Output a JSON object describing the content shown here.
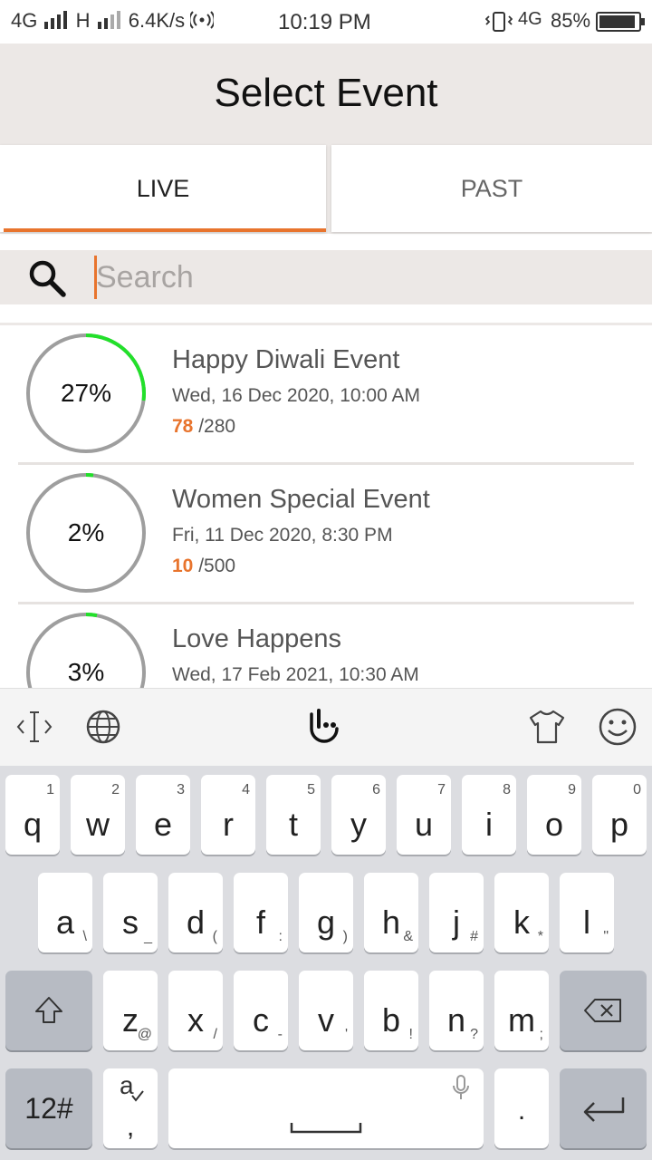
{
  "status_bar": {
    "network_left": "4G",
    "network_h": "H",
    "speed": "6.4K/s",
    "time": "10:19 PM",
    "network_right": "4G",
    "battery": "85%"
  },
  "header": {
    "title": "Select Event"
  },
  "tabs": [
    {
      "label": "LIVE",
      "active": true
    },
    {
      "label": "PAST",
      "active": false
    }
  ],
  "search": {
    "placeholder": "Search",
    "value": ""
  },
  "events": [
    {
      "title": "Happy Diwali Event",
      "date": "Wed, 16 Dec 2020, 10:00 AM",
      "booked": "78",
      "capacity": "/280",
      "percent_label": "27%",
      "progress": 0.27
    },
    {
      "title": "Women Special Event",
      "date": "Fri, 11 Dec 2020, 8:30 PM",
      "booked": "10",
      "capacity": "/500",
      "percent_label": "2%",
      "progress": 0.02
    },
    {
      "title": "Love Happens",
      "date": "Wed, 17 Feb 2021, 10:30 AM",
      "booked": "",
      "capacity": "",
      "percent_label": "3%",
      "progress": 0.03
    }
  ],
  "colors": {
    "accent": "#e8742d",
    "progress": "#22e02a",
    "ring_track": "#9e9e9e",
    "header_bg": "#ece8e6"
  },
  "keyboard": {
    "toolbar_icons": [
      "cursor-icon",
      "globe-icon",
      "gesture-hand-icon",
      "theme-shirt-icon",
      "emoji-icon"
    ],
    "row1": [
      {
        "k": "q",
        "h": "1"
      },
      {
        "k": "w",
        "h": "2"
      },
      {
        "k": "e",
        "h": "3"
      },
      {
        "k": "r",
        "h": "4"
      },
      {
        "k": "t",
        "h": "5"
      },
      {
        "k": "y",
        "h": "6"
      },
      {
        "k": "u",
        "h": "7"
      },
      {
        "k": "i",
        "h": "8"
      },
      {
        "k": "o",
        "h": "9"
      },
      {
        "k": "p",
        "h": "0"
      }
    ],
    "row2": [
      {
        "k": "a",
        "h": "\\"
      },
      {
        "k": "s",
        "h": "_"
      },
      {
        "k": "d",
        "h": "("
      },
      {
        "k": "f",
        "h": ":"
      },
      {
        "k": "g",
        "h": ")"
      },
      {
        "k": "h",
        "h": "&"
      },
      {
        "k": "j",
        "h": "#"
      },
      {
        "k": "k",
        "h": "*"
      },
      {
        "k": "l",
        "h": "\""
      }
    ],
    "row3": [
      {
        "k": "z",
        "h": "@"
      },
      {
        "k": "x",
        "h": "/"
      },
      {
        "k": "c",
        "h": "-"
      },
      {
        "k": "v",
        "h": "'"
      },
      {
        "k": "b",
        "h": "!"
      },
      {
        "k": "n",
        "h": "?"
      },
      {
        "k": "m",
        "h": ";"
      }
    ],
    "numbers_label": "12#",
    "comma_label": ",",
    "period_label": "."
  }
}
